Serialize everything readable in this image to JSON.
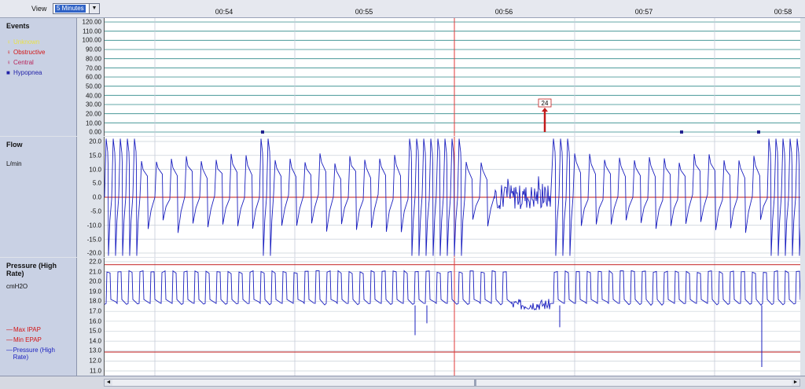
{
  "toolbar": {
    "view_label": "View",
    "view_value": "5 Minutes"
  },
  "time_axis": [
    "00:54",
    "00:55",
    "00:56",
    "00:57",
    "00:58"
  ],
  "colors": {
    "trace": "#1a1fbf",
    "grid": "#2f8a8a",
    "reference": "#c21b1b",
    "cursor": "#e03a3a"
  },
  "panels": {
    "events": {
      "title": "Events",
      "legend": [
        {
          "label": "Unknown",
          "color": "#e8e04a",
          "icon": "pin-icon"
        },
        {
          "label": "Obstructive",
          "color": "#d31515",
          "icon": "pin-icon"
        },
        {
          "label": "Central",
          "color": "#b8255a",
          "icon": "pin-icon"
        },
        {
          "label": "Hypopnea",
          "color": "#2222a8",
          "icon": "square-icon"
        }
      ],
      "yticks": [
        "120.00",
        "110.00",
        "100.00",
        "90.00",
        "80.00",
        "70.00",
        "60.00",
        "50.00",
        "40.00",
        "30.00",
        "20.00",
        "10.00",
        "0.00"
      ],
      "marker_label": "24"
    },
    "flow": {
      "title": "Flow",
      "unit": "L/min",
      "yticks": [
        "20.0",
        "15.0",
        "10.0",
        "5.0",
        "0.0",
        "-5.0",
        "-10.0",
        "-15.0",
        "-20.0"
      ]
    },
    "pressure": {
      "title": "Pressure (High Rate)",
      "unit": "cmH2O",
      "legend": [
        {
          "label": "Max IPAP",
          "color": "#d31515"
        },
        {
          "label": "Min EPAP",
          "color": "#d31515"
        },
        {
          "label": "Pressure (High Rate)",
          "color": "#1a1fbf"
        }
      ],
      "yticks": [
        "22.0",
        "21.0",
        "20.0",
        "19.0",
        "18.0",
        "17.0",
        "16.0",
        "15.0",
        "14.0",
        "13.0",
        "12.0",
        "11.0"
      ]
    }
  },
  "chart_data": [
    {
      "type": "scatter",
      "title": "Events",
      "xlabel": "",
      "ylabel": "",
      "xlim": [
        "00:53:45",
        "00:58:05"
      ],
      "ylim": [
        0,
        120
      ],
      "series": [
        {
          "name": "Hypopnea",
          "x": [
            "00:54:15",
            "00:57:15",
            "00:57:50"
          ],
          "values": [
            0,
            0,
            0
          ]
        },
        {
          "name": "Obstructive",
          "x": [
            "00:56:20"
          ],
          "values": [
            24
          ],
          "labels": [
            "24"
          ]
        }
      ]
    },
    {
      "type": "line",
      "title": "Flow",
      "ylabel": "L/min",
      "ylim": [
        -20,
        20
      ],
      "reference_line": 0,
      "breath_cycles": 46
    },
    {
      "type": "line",
      "title": "Pressure (High Rate)",
      "ylabel": "cmH2O",
      "ylim": [
        11,
        22
      ],
      "series": [
        {
          "name": "Max IPAP",
          "values": [
            21.7
          ]
        },
        {
          "name": "Min EPAP",
          "values": [
            12.9
          ]
        },
        {
          "name": "Pressure (High Rate)",
          "baseline": 17.7,
          "peak": 21.0
        }
      ]
    }
  ]
}
